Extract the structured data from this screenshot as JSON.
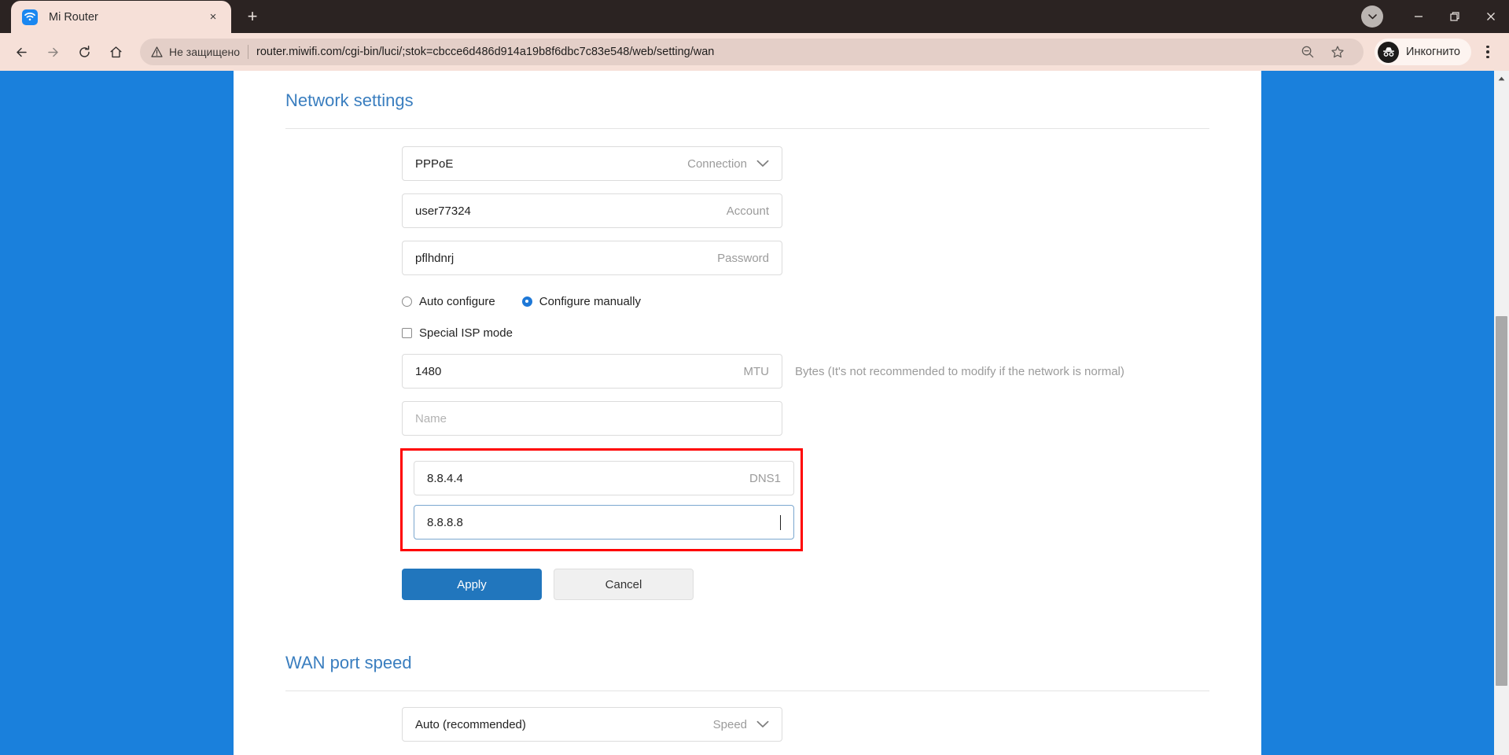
{
  "browser": {
    "tab": {
      "title": "Mi Router",
      "favicon": "wifi-icon",
      "close_label": "×"
    },
    "new_tab_label": "+",
    "window_controls": {
      "tab_search": "▼",
      "minimize": "—",
      "maximize": "❐",
      "close": "✕"
    },
    "toolbar": {
      "back": "←",
      "forward": "→",
      "reload": "⟳",
      "home": "⌂",
      "security_status": "Не защищено",
      "url": "router.miwifi.com/cgi-bin/luci/;stok=cbcce6d486d914a19b8f6dbc7c83e548/web/setting/wan",
      "zoom_out": "zoom-out-icon",
      "bookmark": "☆",
      "profile_label": "Инкогнито",
      "menu": "⋮"
    }
  },
  "colors": {
    "page_bg": "#1a80dc",
    "accent_blue": "#3a7ebf",
    "primary_button": "#2176bd",
    "highlight_red": "#ff0000",
    "radio_on": "#1e78d7"
  },
  "network_settings": {
    "title": "Network settings",
    "fields": {
      "connection": {
        "value": "PPPoE",
        "label": "Connection",
        "has_chevron": true
      },
      "account": {
        "value": "user77324",
        "label": "Account"
      },
      "password": {
        "value": "pflhdnrj",
        "label": "Password"
      },
      "mtu": {
        "value": "1480",
        "label": "MTU",
        "hint": "Bytes (It's not recommended to modify if the network is normal)"
      },
      "name": {
        "value": "",
        "placeholder": "Name",
        "label": ""
      },
      "dns1": {
        "value": "8.8.4.4",
        "label": "DNS1"
      },
      "dns2": {
        "value": "8.8.8.8",
        "label": "",
        "focused": true
      }
    },
    "config_mode": {
      "auto": {
        "label": "Auto configure",
        "checked": false
      },
      "manual": {
        "label": "Configure manually",
        "checked": true
      }
    },
    "special_isp": {
      "label": "Special ISP mode",
      "checked": false
    },
    "buttons": {
      "apply": "Apply",
      "cancel": "Cancel"
    }
  },
  "wan_port_speed": {
    "title": "WAN port speed",
    "speed": {
      "value": "Auto (recommended)",
      "label": "Speed"
    }
  }
}
